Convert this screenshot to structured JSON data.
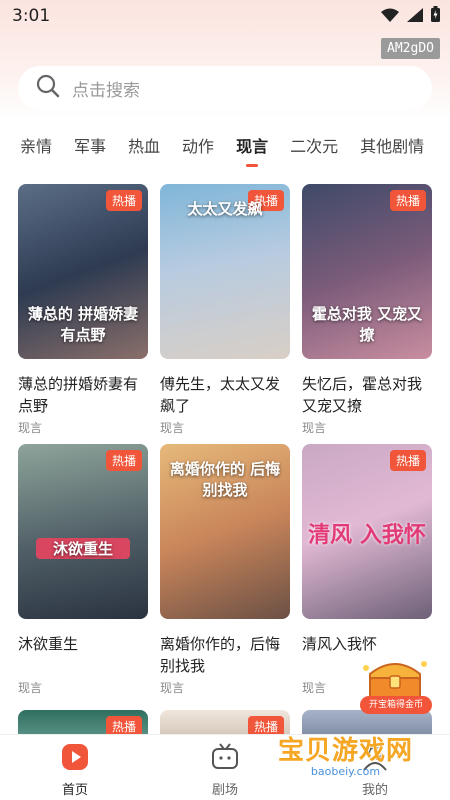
{
  "status": {
    "time": "3:01"
  },
  "watermark_id": "AM2gDO",
  "search": {
    "placeholder": "点击搜索"
  },
  "tabs": [
    {
      "label": "亲情",
      "active": false
    },
    {
      "label": "军事",
      "active": false
    },
    {
      "label": "热血",
      "active": false
    },
    {
      "label": "动作",
      "active": false
    },
    {
      "label": "现言",
      "active": true
    },
    {
      "label": "二次元",
      "active": false
    },
    {
      "label": "其他剧情",
      "active": false
    }
  ],
  "cards": [
    {
      "title": "薄总的拼婚娇妻有点野",
      "genre": "现言",
      "badge": "热播",
      "poster_text": "薄总的 拼婚娇妻有点野"
    },
    {
      "title": "傅先生，太太又发飙了",
      "genre": "现言",
      "badge": "热播",
      "poster_text": "太太又发飙"
    },
    {
      "title": "失忆后，霍总对我又宠又撩",
      "genre": "现言",
      "badge": "热播",
      "poster_text": "霍总对我 又宠又撩"
    },
    {
      "title": "沐欲重生",
      "genre": "现言",
      "badge": "热播",
      "poster_text": "沐欲重生"
    },
    {
      "title": "离婚你作的，后悔别找我",
      "genre": "现言",
      "badge": "",
      "poster_text": "离婚你作的 后悔别找我"
    },
    {
      "title": "清风入我怀",
      "genre": "现言",
      "badge": "热播",
      "poster_text": "清风 入我怀"
    }
  ],
  "row3_badges": [
    "热播",
    "热播",
    ""
  ],
  "treasure": {
    "label": "开宝箱得金币"
  },
  "site_watermark": {
    "name": "宝贝游戏网",
    "url": "baobeiy.com"
  },
  "nav": [
    {
      "label": "首页",
      "active": true,
      "icon": "play-icon"
    },
    {
      "label": "剧场",
      "active": false,
      "icon": "tv-icon"
    },
    {
      "label": "我的",
      "active": false,
      "icon": "user-icon"
    }
  ],
  "colors": {
    "accent": "#f1553a",
    "badge": "#f1553a"
  }
}
